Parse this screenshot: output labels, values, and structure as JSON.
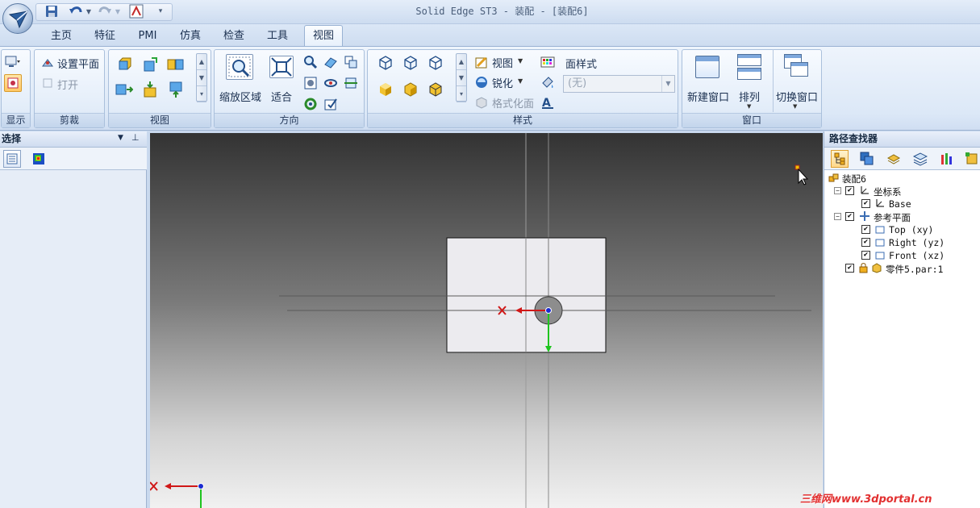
{
  "window": {
    "title": "Solid Edge ST3 - 装配 - [装配6]"
  },
  "tabs": [
    "主页",
    "特征",
    "PMI",
    "仿真",
    "检查",
    "工具",
    "视图"
  ],
  "active_tab": "视图",
  "ribbon": {
    "display": {
      "label": "显示"
    },
    "clip": {
      "label": "剪裁",
      "set_plane": "设置平面",
      "open": "打开"
    },
    "views": {
      "label": "视图"
    },
    "orient": {
      "label": "方向",
      "zoom_area": "缩放区域",
      "fit": "适合"
    },
    "style": {
      "label": "样式",
      "view": "视图",
      "sharpen": "锐化",
      "format_view": "格式化面",
      "face_style_label": "面样式",
      "face_style_value": "(无)"
    },
    "window": {
      "label": "窗口",
      "new_window": "新建窗口",
      "arrange": "排列",
      "switch_window": "切换窗口"
    }
  },
  "left_pane": {
    "title": "选择"
  },
  "right_pane": {
    "title": "路径查找器",
    "tree": {
      "root": "装配6",
      "coord_system": "坐标系",
      "base": "Base",
      "ref_planes": "参考平面",
      "top": "Top (xy)",
      "right": "Right (yz)",
      "front": "Front (xz)",
      "part": "零件5.par:1"
    }
  },
  "watermark": "三维网www.3dportal.cn",
  "colors": {
    "accent": "#cddcf0",
    "axis_x": "#d01818",
    "axis_y": "#1fc41f",
    "viewport_dark": "#333333",
    "viewport_light": "#f1f1f1"
  }
}
